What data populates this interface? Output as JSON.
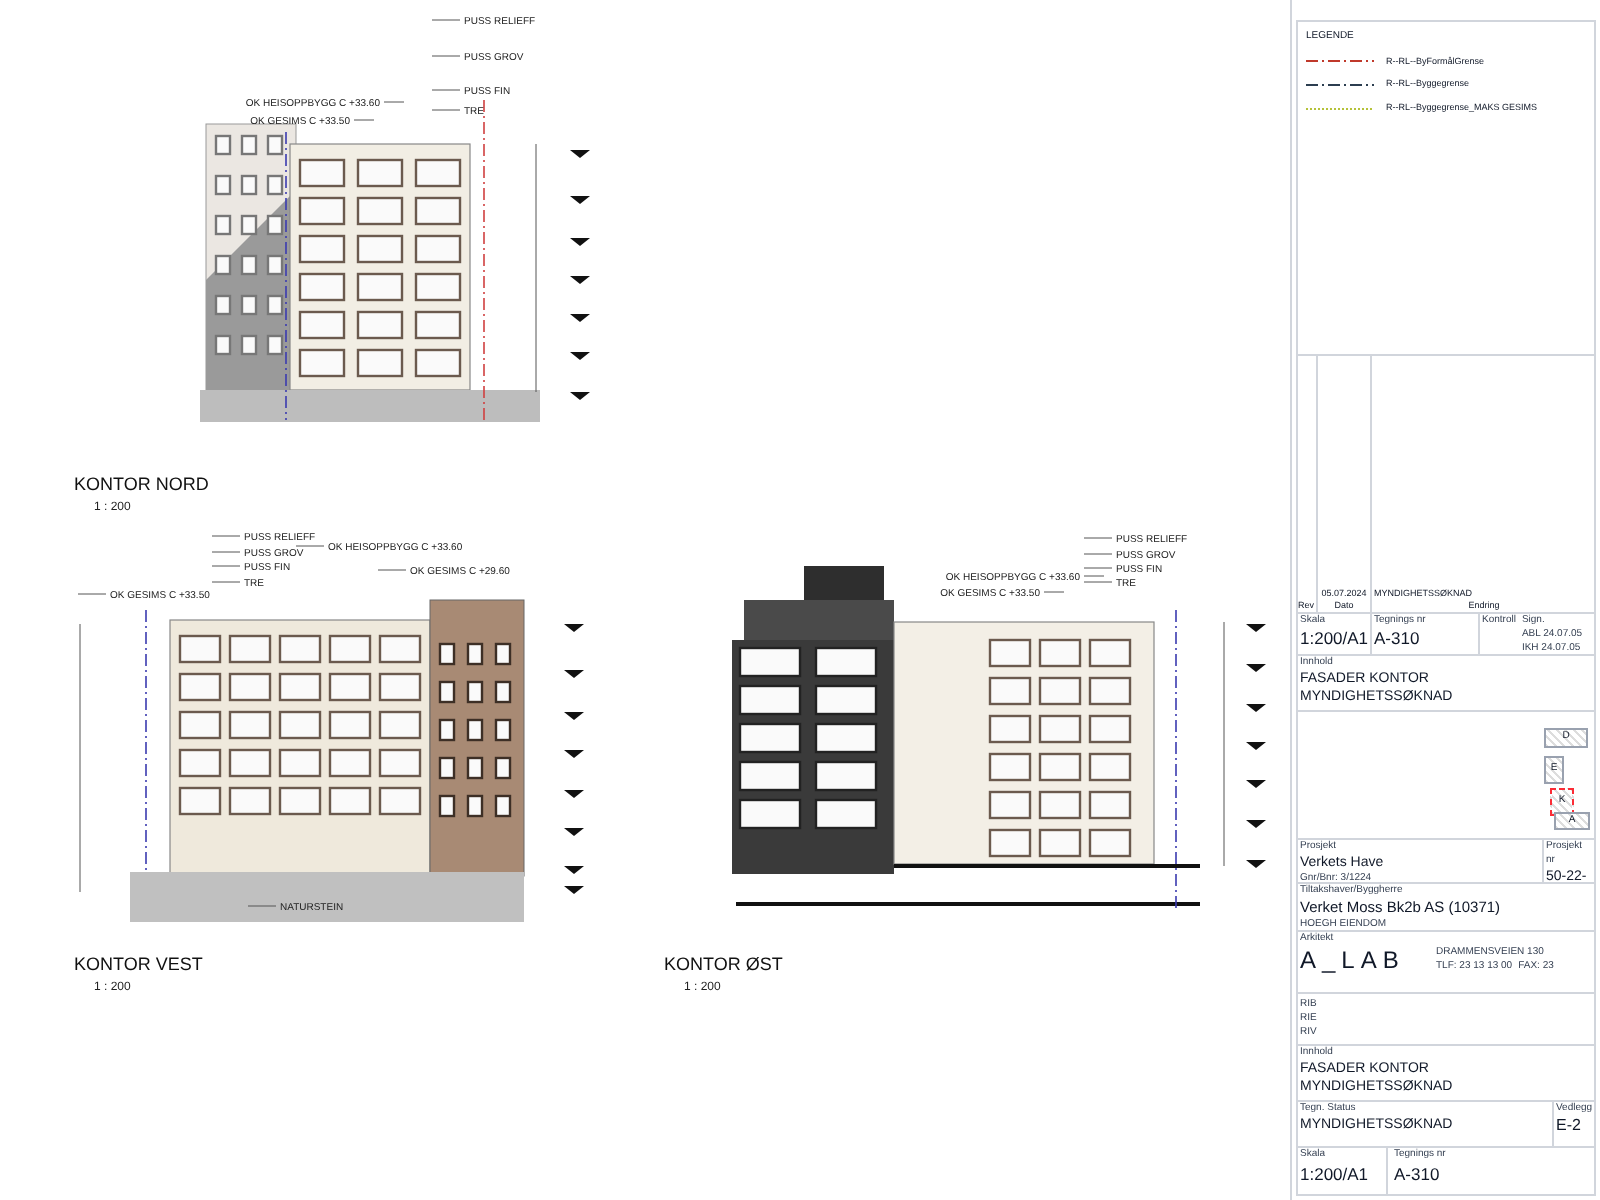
{
  "views": [
    {
      "kind": "nord",
      "title": "KONTOR NORD",
      "scale": "1 : 200",
      "callouts": [
        "PUSS RELIEFF",
        "PUSS GROV",
        "PUSS FIN",
        "OK HEISOPPBYGG C +33.60",
        "TRE",
        "OK GESIMS C +33.50"
      ]
    },
    {
      "kind": "vest",
      "title": "KONTOR VEST",
      "scale": "1 : 200",
      "callouts": [
        "PUSS RELIEFF",
        "PUSS GROV",
        "PUSS FIN",
        "TRE",
        "OK HEISOPPBYGG C +33.60",
        "OK GESIMS C +29.60",
        "OK GESIMS C +33.50",
        "NATURSTEIN"
      ]
    },
    {
      "kind": "ost",
      "title": "KONTOR ØST",
      "scale": "1 : 200",
      "callouts": [
        "PUSS RELIEFF",
        "PUSS GROV",
        "PUSS FIN",
        "OK HEISOPPBYGG C +33.60",
        "TRE",
        "OK GESIMS C +33.50"
      ]
    }
  ],
  "legend": {
    "title": "LEGENDE",
    "items": [
      {
        "label": "R--RL--ByFormålGrense",
        "kind": "dash-dot",
        "color": "#c0392b"
      },
      {
        "label": "R--RL--Byggegrense",
        "kind": "dash-dot",
        "color": "#2c3e50"
      },
      {
        "label": "R--RL--Byggegrense_MAKS GESIMS",
        "kind": "dotted",
        "color": "#b5c23a"
      }
    ]
  },
  "revision": {
    "date": "05.07.2024",
    "change": "MYNDIGHETSSØKNAD",
    "headers": [
      "Rev",
      "Dato",
      "Endring"
    ]
  },
  "top_scale": {
    "label": "Skala",
    "value": "1:200/A1",
    "drawing_label": "Tegnings nr",
    "drawing_no": "A-310",
    "control_label": "Kontroll",
    "sign_label": "Sign.",
    "control_rows": [
      "ABL 24.07.05",
      "IKH 24.07.05"
    ]
  },
  "content_1": {
    "label": "Innhold",
    "lines": [
      "FASADER KONTOR",
      "MYNDIGHETSSØKNAD"
    ]
  },
  "key_plan": [
    {
      "label": "D",
      "selected": false
    },
    {
      "label": "E",
      "selected": false
    },
    {
      "label": "K",
      "selected": true
    },
    {
      "label": "A",
      "selected": false
    }
  ],
  "project": {
    "label": "Prosjekt",
    "name": "Verkets Have",
    "sub": "Gnr/Bnr: 3/1224",
    "no_label": "Prosjekt nr",
    "no": "50-22-"
  },
  "client": {
    "label": "Tiltakshaver/Byggherre",
    "name": "Verket Moss Bk2b AS (10371)",
    "sub": "HOEGH EIENDOM"
  },
  "architect": {
    "label": "Arkitekt",
    "logo": "A_LAB",
    "address": "DRAMMENSVEIEN 130",
    "phone": "TLF: 23 13 13 00",
    "fax": "FAX: 23"
  },
  "consultants": [
    "RIB",
    "RIE",
    "RIV"
  ],
  "content_2": {
    "label": "Innhold",
    "lines": [
      "FASADER KONTOR",
      "MYNDIGHETSSØKNAD"
    ]
  },
  "status": {
    "label": "Tegn. Status",
    "value": "MYNDIGHETSSØKNAD",
    "attachment_label": "Vedlegg",
    "attachment": "E-2"
  },
  "bottom_scale": {
    "label": "Skala",
    "value": "1:200/A1",
    "drawing_label": "Tegnings nr",
    "drawing_no": "A-310"
  }
}
